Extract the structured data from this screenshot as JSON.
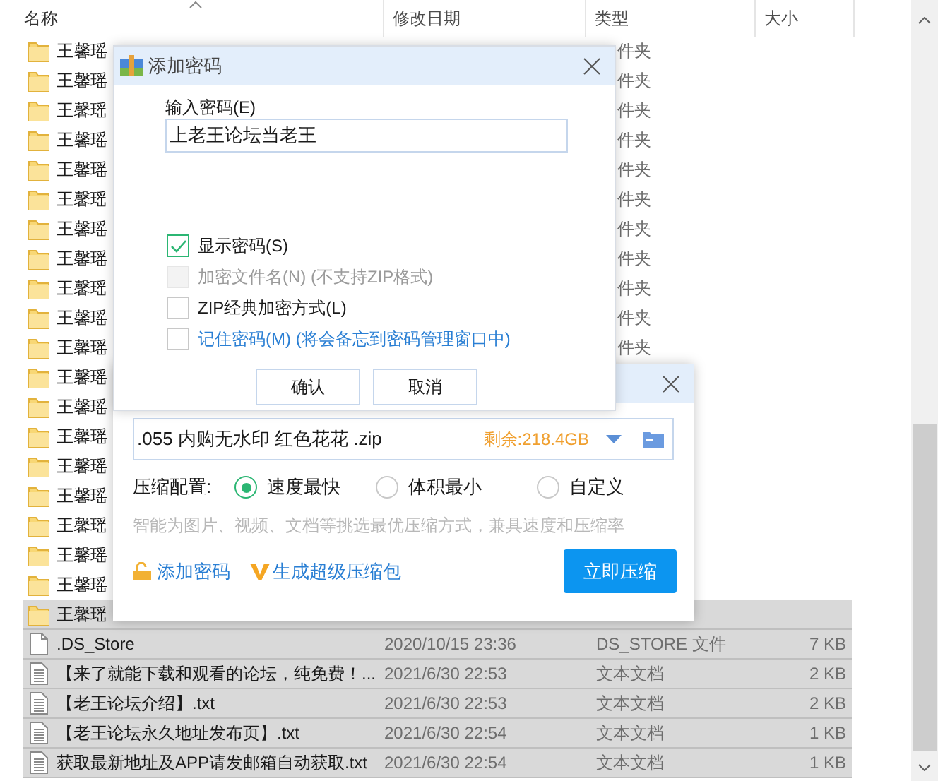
{
  "file_list": {
    "columns": [
      {
        "label": "名称",
        "sorted": true
      },
      {
        "label": "修改日期",
        "sorted": false
      },
      {
        "label": "类型",
        "sorted": false
      },
      {
        "label": "大小",
        "sorted": false
      }
    ],
    "rows": [
      {
        "kind": "folder",
        "name": "王馨瑶",
        "type": "件夹",
        "selected": false
      },
      {
        "kind": "folder",
        "name": "王馨瑶",
        "type": "件夹",
        "selected": false
      },
      {
        "kind": "folder",
        "name": "王馨瑶",
        "type": "件夹",
        "selected": false
      },
      {
        "kind": "folder",
        "name": "王馨瑶",
        "type": "件夹",
        "selected": false
      },
      {
        "kind": "folder",
        "name": "王馨瑶",
        "type": "件夹",
        "selected": false
      },
      {
        "kind": "folder",
        "name": "王馨瑶",
        "type": "件夹",
        "selected": false
      },
      {
        "kind": "folder",
        "name": "王馨瑶",
        "type": "件夹",
        "selected": false
      },
      {
        "kind": "folder",
        "name": "王馨瑶",
        "type": "件夹",
        "selected": false
      },
      {
        "kind": "folder",
        "name": "王馨瑶",
        "type": "件夹",
        "selected": false
      },
      {
        "kind": "folder",
        "name": "王馨瑶",
        "type": "件夹",
        "selected": false
      },
      {
        "kind": "folder",
        "name": "王馨瑶",
        "type": "件夹",
        "selected": false
      },
      {
        "kind": "folder",
        "name": "王馨瑶",
        "selected": false
      },
      {
        "kind": "folder",
        "name": "王馨瑶",
        "selected": false
      },
      {
        "kind": "folder",
        "name": "王馨瑶",
        "selected": false
      },
      {
        "kind": "folder",
        "name": "王馨瑶",
        "selected": false
      },
      {
        "kind": "folder",
        "name": "王馨瑶",
        "selected": false
      },
      {
        "kind": "folder",
        "name": "王馨瑶",
        "selected": false
      },
      {
        "kind": "folder",
        "name": "王馨瑶",
        "selected": false
      },
      {
        "kind": "folder",
        "name": "王馨瑶",
        "selected": false
      },
      {
        "kind": "folder",
        "name": "王馨瑶",
        "selected": true
      },
      {
        "kind": "file",
        "name": ".DS_Store",
        "date": "2020/10/15 23:36",
        "type": "DS_STORE 文件",
        "size": "7 KB",
        "selected": true
      },
      {
        "kind": "text",
        "name": "【来了就能下载和观看的论坛，纯免费！...",
        "date": "2021/6/30 22:53",
        "type": "文本文档",
        "size": "2 KB",
        "selected": true
      },
      {
        "kind": "text",
        "name": "【老王论坛介绍】.txt",
        "date": "2021/6/30 22:53",
        "type": "文本文档",
        "size": "2 KB",
        "selected": true
      },
      {
        "kind": "text",
        "name": "【老王论坛永久地址发布页】.txt",
        "date": "2021/6/30 22:54",
        "type": "文本文档",
        "size": "1 KB",
        "selected": true
      },
      {
        "kind": "text",
        "name": "获取最新地址及APP请发邮箱自动获取.txt",
        "date": "2021/6/30 22:54",
        "type": "文本文档",
        "size": "1 KB",
        "selected": true
      }
    ]
  },
  "password_dialog": {
    "title": "添加密码",
    "field_label": "输入密码(E)",
    "password": "上老王论坛当老王",
    "options": [
      {
        "label": "显示密码(S)",
        "checked": true,
        "disabled": false,
        "link": false
      },
      {
        "label": "加密文件名(N) (不支持ZIP格式)",
        "checked": false,
        "disabled": true,
        "link": false
      },
      {
        "label": "ZIP经典加密方式(L)",
        "checked": false,
        "disabled": false,
        "link": false
      },
      {
        "label": "记住密码(M) (将会备忘到密码管理窗口中)",
        "checked": false,
        "disabled": false,
        "link": true
      }
    ],
    "buttons": [
      "确认",
      "取消"
    ]
  },
  "compress_dialog": {
    "path": ".055 内购无水印 红色花花 .zip",
    "free_space": "剩余:218.4GB",
    "config_label": "压缩配置:",
    "modes": [
      {
        "label": "速度最快",
        "selected": true
      },
      {
        "label": "体积最小",
        "selected": false
      },
      {
        "label": "自定义",
        "selected": false
      }
    ],
    "hint": "智能为图片、视频、文档等挑选最优压缩方式，兼具速度和压缩率",
    "add_password": "添加密码",
    "super_package": "生成超级压缩包",
    "compress_button": "立即压缩"
  }
}
